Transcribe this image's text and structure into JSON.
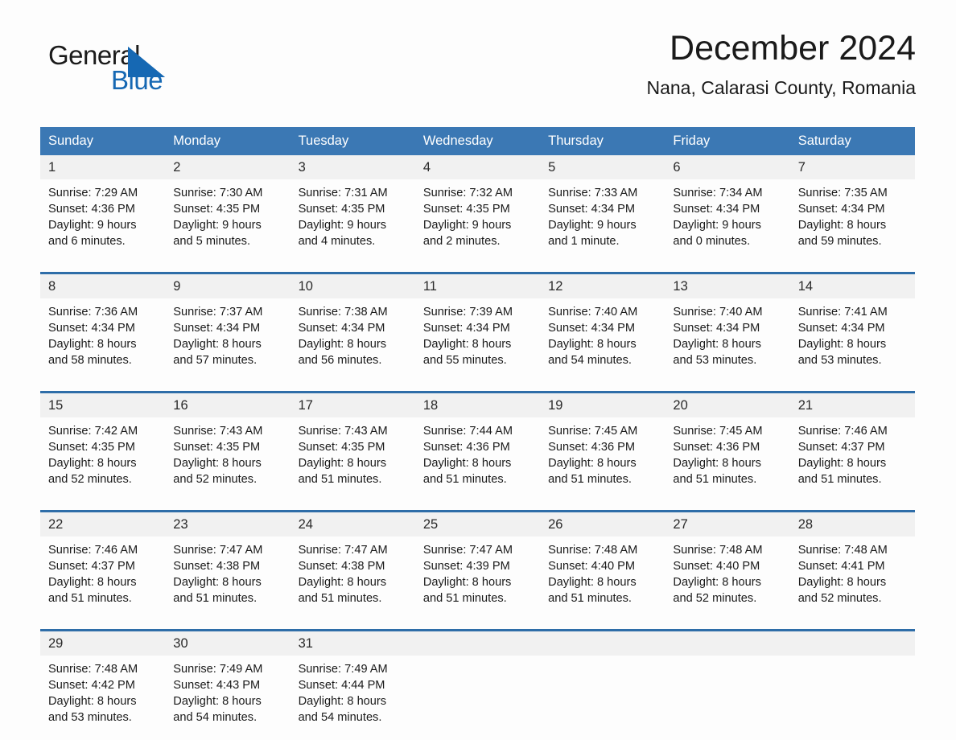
{
  "brand": {
    "word_one": "General",
    "word_two": "Blue",
    "triangle_color": "#1668b3",
    "text_color": "#1b1b1b"
  },
  "header": {
    "title": "December 2024",
    "location": "Nana, Calarasi County, Romania"
  },
  "colors": {
    "header_blue": "#3b78b4",
    "rule_blue": "#2e6da8",
    "date_band": "#f1f1f1",
    "page_background": "#fdfdfd"
  },
  "weekdays": [
    "Sunday",
    "Monday",
    "Tuesday",
    "Wednesday",
    "Thursday",
    "Friday",
    "Saturday"
  ],
  "weeks": [
    {
      "days": [
        {
          "date": "1",
          "lines": [
            "Sunrise: 7:29 AM",
            "Sunset: 4:36 PM",
            "Daylight: 9 hours",
            "and 6 minutes."
          ]
        },
        {
          "date": "2",
          "lines": [
            "Sunrise: 7:30 AM",
            "Sunset: 4:35 PM",
            "Daylight: 9 hours",
            "and 5 minutes."
          ]
        },
        {
          "date": "3",
          "lines": [
            "Sunrise: 7:31 AM",
            "Sunset: 4:35 PM",
            "Daylight: 9 hours",
            "and 4 minutes."
          ]
        },
        {
          "date": "4",
          "lines": [
            "Sunrise: 7:32 AM",
            "Sunset: 4:35 PM",
            "Daylight: 9 hours",
            "and 2 minutes."
          ]
        },
        {
          "date": "5",
          "lines": [
            "Sunrise: 7:33 AM",
            "Sunset: 4:34 PM",
            "Daylight: 9 hours",
            "and 1 minute."
          ]
        },
        {
          "date": "6",
          "lines": [
            "Sunrise: 7:34 AM",
            "Sunset: 4:34 PM",
            "Daylight: 9 hours",
            "and 0 minutes."
          ]
        },
        {
          "date": "7",
          "lines": [
            "Sunrise: 7:35 AM",
            "Sunset: 4:34 PM",
            "Daylight: 8 hours",
            "and 59 minutes."
          ]
        }
      ]
    },
    {
      "days": [
        {
          "date": "8",
          "lines": [
            "Sunrise: 7:36 AM",
            "Sunset: 4:34 PM",
            "Daylight: 8 hours",
            "and 58 minutes."
          ]
        },
        {
          "date": "9",
          "lines": [
            "Sunrise: 7:37 AM",
            "Sunset: 4:34 PM",
            "Daylight: 8 hours",
            "and 57 minutes."
          ]
        },
        {
          "date": "10",
          "lines": [
            "Sunrise: 7:38 AM",
            "Sunset: 4:34 PM",
            "Daylight: 8 hours",
            "and 56 minutes."
          ]
        },
        {
          "date": "11",
          "lines": [
            "Sunrise: 7:39 AM",
            "Sunset: 4:34 PM",
            "Daylight: 8 hours",
            "and 55 minutes."
          ]
        },
        {
          "date": "12",
          "lines": [
            "Sunrise: 7:40 AM",
            "Sunset: 4:34 PM",
            "Daylight: 8 hours",
            "and 54 minutes."
          ]
        },
        {
          "date": "13",
          "lines": [
            "Sunrise: 7:40 AM",
            "Sunset: 4:34 PM",
            "Daylight: 8 hours",
            "and 53 minutes."
          ]
        },
        {
          "date": "14",
          "lines": [
            "Sunrise: 7:41 AM",
            "Sunset: 4:34 PM",
            "Daylight: 8 hours",
            "and 53 minutes."
          ]
        }
      ]
    },
    {
      "days": [
        {
          "date": "15",
          "lines": [
            "Sunrise: 7:42 AM",
            "Sunset: 4:35 PM",
            "Daylight: 8 hours",
            "and 52 minutes."
          ]
        },
        {
          "date": "16",
          "lines": [
            "Sunrise: 7:43 AM",
            "Sunset: 4:35 PM",
            "Daylight: 8 hours",
            "and 52 minutes."
          ]
        },
        {
          "date": "17",
          "lines": [
            "Sunrise: 7:43 AM",
            "Sunset: 4:35 PM",
            "Daylight: 8 hours",
            "and 51 minutes."
          ]
        },
        {
          "date": "18",
          "lines": [
            "Sunrise: 7:44 AM",
            "Sunset: 4:36 PM",
            "Daylight: 8 hours",
            "and 51 minutes."
          ]
        },
        {
          "date": "19",
          "lines": [
            "Sunrise: 7:45 AM",
            "Sunset: 4:36 PM",
            "Daylight: 8 hours",
            "and 51 minutes."
          ]
        },
        {
          "date": "20",
          "lines": [
            "Sunrise: 7:45 AM",
            "Sunset: 4:36 PM",
            "Daylight: 8 hours",
            "and 51 minutes."
          ]
        },
        {
          "date": "21",
          "lines": [
            "Sunrise: 7:46 AM",
            "Sunset: 4:37 PM",
            "Daylight: 8 hours",
            "and 51 minutes."
          ]
        }
      ]
    },
    {
      "days": [
        {
          "date": "22",
          "lines": [
            "Sunrise: 7:46 AM",
            "Sunset: 4:37 PM",
            "Daylight: 8 hours",
            "and 51 minutes."
          ]
        },
        {
          "date": "23",
          "lines": [
            "Sunrise: 7:47 AM",
            "Sunset: 4:38 PM",
            "Daylight: 8 hours",
            "and 51 minutes."
          ]
        },
        {
          "date": "24",
          "lines": [
            "Sunrise: 7:47 AM",
            "Sunset: 4:38 PM",
            "Daylight: 8 hours",
            "and 51 minutes."
          ]
        },
        {
          "date": "25",
          "lines": [
            "Sunrise: 7:47 AM",
            "Sunset: 4:39 PM",
            "Daylight: 8 hours",
            "and 51 minutes."
          ]
        },
        {
          "date": "26",
          "lines": [
            "Sunrise: 7:48 AM",
            "Sunset: 4:40 PM",
            "Daylight: 8 hours",
            "and 51 minutes."
          ]
        },
        {
          "date": "27",
          "lines": [
            "Sunrise: 7:48 AM",
            "Sunset: 4:40 PM",
            "Daylight: 8 hours",
            "and 52 minutes."
          ]
        },
        {
          "date": "28",
          "lines": [
            "Sunrise: 7:48 AM",
            "Sunset: 4:41 PM",
            "Daylight: 8 hours",
            "and 52 minutes."
          ]
        }
      ]
    },
    {
      "days": [
        {
          "date": "29",
          "lines": [
            "Sunrise: 7:48 AM",
            "Sunset: 4:42 PM",
            "Daylight: 8 hours",
            "and 53 minutes."
          ]
        },
        {
          "date": "30",
          "lines": [
            "Sunrise: 7:49 AM",
            "Sunset: 4:43 PM",
            "Daylight: 8 hours",
            "and 54 minutes."
          ]
        },
        {
          "date": "31",
          "lines": [
            "Sunrise: 7:49 AM",
            "Sunset: 4:44 PM",
            "Daylight: 8 hours",
            "and 54 minutes."
          ]
        },
        {
          "date": "",
          "lines": []
        },
        {
          "date": "",
          "lines": []
        },
        {
          "date": "",
          "lines": []
        },
        {
          "date": "",
          "lines": []
        }
      ]
    }
  ]
}
